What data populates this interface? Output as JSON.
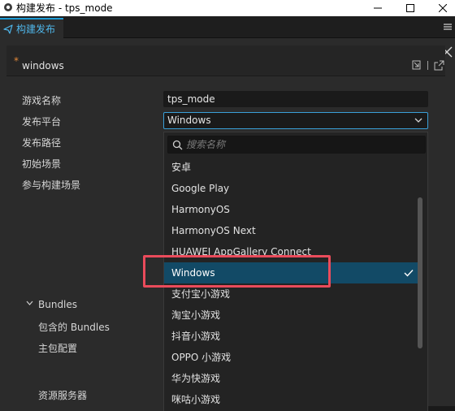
{
  "window": {
    "title": "构建发布 - tps_mode"
  },
  "tab": {
    "label": "构建发布"
  },
  "header": {
    "title": "windows"
  },
  "form": {
    "required_mark": "*",
    "labels": {
      "game_name": "游戏名称",
      "platform": "发布平台",
      "build_path": "发布路径",
      "start_scene": "初始场景",
      "included_scenes": "参与构建场景",
      "bundles": "Bundles",
      "included_bundles": "包含的 Bundles",
      "main_package": "主包配置",
      "resource_server": "资源服务器"
    },
    "game_name_value": "tps_mode",
    "platform_value": "Windows"
  },
  "dropdown": {
    "search_placeholder": "搜索名称",
    "selected_index": 5,
    "items": [
      {
        "label": "安卓"
      },
      {
        "label": "Google Play"
      },
      {
        "label": "HarmonyOS"
      },
      {
        "label": "HarmonyOS Next"
      },
      {
        "label": "HUAWEI AppGallery Connect"
      },
      {
        "label": "Windows"
      },
      {
        "label": "支付宝小游戏"
      },
      {
        "label": "淘宝小游戏"
      },
      {
        "label": "抖音小游戏"
      },
      {
        "label": "OPPO 小游戏"
      },
      {
        "label": "华为快游戏"
      },
      {
        "label": "咪咕小游戏"
      }
    ]
  },
  "colors": {
    "accent": "#1f9bd4",
    "selection": "#124a66",
    "required": "#e4893a",
    "annotation_box": "#ea4b5b"
  }
}
